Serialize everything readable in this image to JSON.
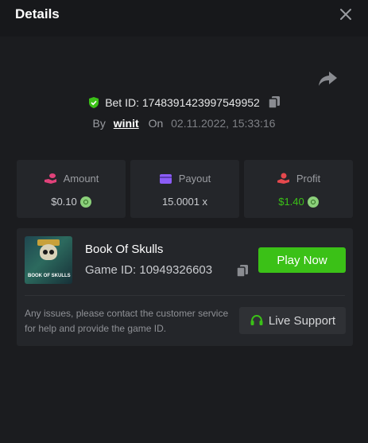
{
  "header": {
    "title": "Details"
  },
  "bet": {
    "id_text": "Bet ID: 1748391423997549952",
    "by_label": "By",
    "user": "winit",
    "on_label": "On",
    "date": "02.11.2022, 15:33:16"
  },
  "stats": [
    {
      "label": "Amount",
      "value": "$0.10",
      "icon": "coins-hand-icon",
      "color": "#e0427a"
    },
    {
      "label": "Payout",
      "value": "15.0001 x",
      "icon": "wallet-icon",
      "color": "#8b5cf6"
    },
    {
      "label": "Profit",
      "value": "$1.40",
      "icon": "hand-coin-icon",
      "color": "#e5484d"
    }
  ],
  "game": {
    "name": "Book Of Skulls",
    "id_text": "Game ID: 10949326603",
    "thumb_title": "BOOK OF SKULLS",
    "play_label": "Play Now",
    "issue_text": "Any issues, please contact the customer service for help and provide the game ID.",
    "support_label": "Live Support"
  },
  "colors": {
    "accent_green": "#3bc117",
    "background": "#1b1c1f",
    "card": "#24262a"
  }
}
